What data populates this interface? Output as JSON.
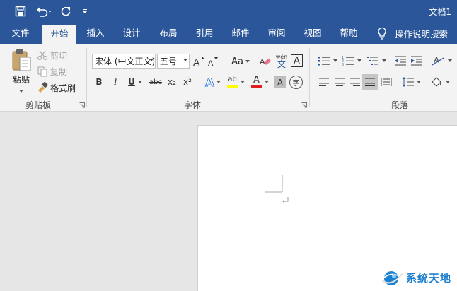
{
  "window": {
    "title": "文档1"
  },
  "tabs": [
    "文件",
    "开始",
    "插入",
    "设计",
    "布局",
    "引用",
    "邮件",
    "审阅",
    "视图",
    "帮助"
  ],
  "active_tab": "开始",
  "tell_me": {
    "label": "操作说明搜索"
  },
  "clipboard": {
    "group_label": "剪贴板",
    "paste_label": "粘贴",
    "cut_label": "剪切",
    "copy_label": "复制",
    "format_painter_label": "格式刷"
  },
  "font": {
    "group_label": "字体",
    "font_name": "宋体 (中文正文)",
    "font_size": "五号",
    "change_case_label": "Aa",
    "clear_format_label": "A",
    "phonetic_label": "wén",
    "phonetic_char": "文",
    "char_border_label": "A",
    "bold_label": "B",
    "italic_label": "I",
    "underline_label": "U",
    "strike_label": "abc",
    "subscript_label": "x₂",
    "superscript_label": "x²",
    "text_effect_label": "A",
    "highlight_label": "ab",
    "font_color_label": "A",
    "char_shading_label": "A",
    "enclose_label": "字"
  },
  "paragraph": {
    "group_label": "段落"
  },
  "watermark": {
    "text": "系统天地"
  },
  "colors": {
    "brand": "#2b579a",
    "ribbon_bg": "#f3f3f3",
    "highlight_yellow": "#ffff00",
    "font_red": "#e02020",
    "watermark_blue": "#1d7fd0"
  }
}
